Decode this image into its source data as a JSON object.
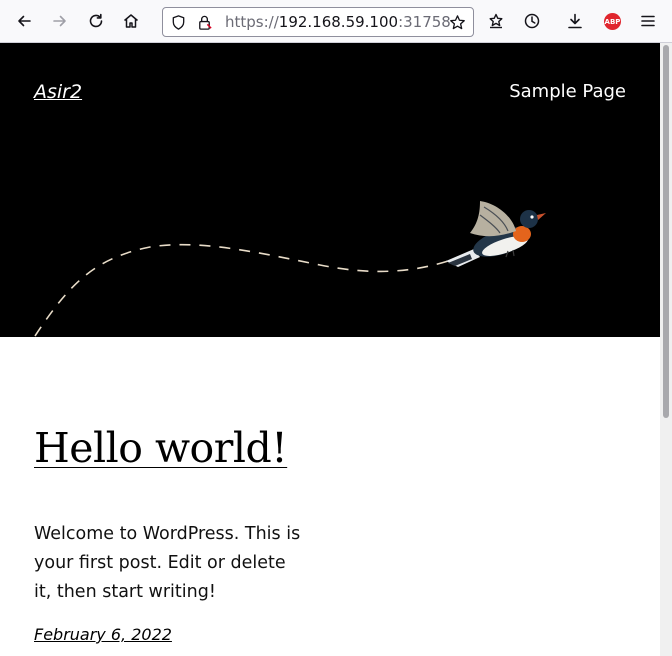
{
  "browser": {
    "url_scheme": "https://",
    "url_host": "192.168.59.100",
    "url_port": ":31758",
    "addon_badge": "ABP",
    "toolbar_icons": [
      "back-icon",
      "forward-icon",
      "reload-icon",
      "home-icon",
      "shield-icon",
      "lock-icon",
      "bookmark-star-icon",
      "extensions-icon",
      "history-icon",
      "download-icon",
      "adblock-plus-icon",
      "menu-icon"
    ]
  },
  "site": {
    "title": "Asir2",
    "nav_label": "Sample Page"
  },
  "post": {
    "title": "Hello world!",
    "excerpt": "Welcome to WordPress. This is your first post. Edit or delete it, then start writing!",
    "date": "February 6, 2022"
  },
  "colors": {
    "header_bg": "#000000",
    "page_bg": "#ffffff",
    "dash_line": "#e8dcc8"
  }
}
